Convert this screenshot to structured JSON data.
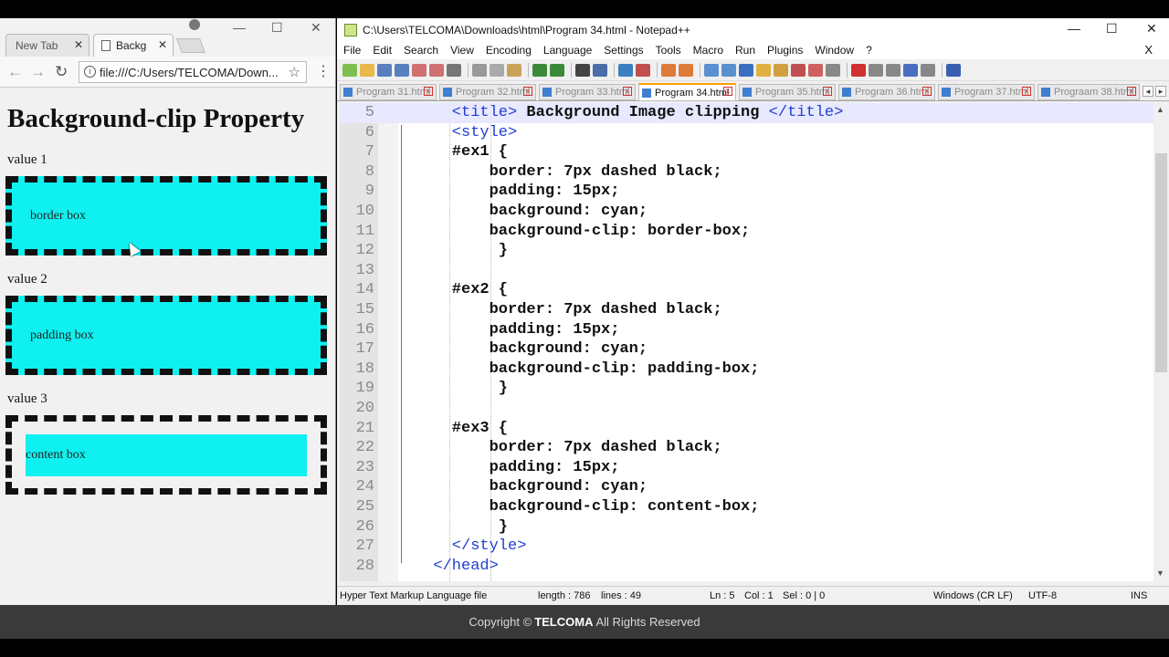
{
  "footer": {
    "prefix": "Copyright ©",
    "brand": "TELCOMA",
    "suffix": "All Rights Reserved"
  },
  "chrome": {
    "tabs": [
      {
        "label": "New Tab"
      },
      {
        "label": "Backg"
      }
    ],
    "url": "file:///C:/Users/TELCOMA/Down...",
    "page": {
      "title": "Background-clip Property",
      "sections": [
        {
          "label": "value 1",
          "box_text": "border box"
        },
        {
          "label": "value 2",
          "box_text": "padding box"
        },
        {
          "label": "value 3",
          "box_text": "content box"
        }
      ]
    }
  },
  "npp": {
    "title": "C:\\Users\\TELCOMA\\Downloads\\html\\Program 34.html - Notepad++",
    "menu": [
      "File",
      "Edit",
      "Search",
      "View",
      "Encoding",
      "Language",
      "Settings",
      "Tools",
      "Macro",
      "Run",
      "Plugins",
      "Window",
      "?"
    ],
    "menu_close": "X",
    "tabs": [
      "Program 31.html",
      "Program 32.html",
      "Program 33.html",
      "Program 34.html",
      "Program 35.html",
      "Program 36.html",
      "Program 37.html",
      "Prograam 38.html"
    ],
    "lines": [
      {
        "n": "5",
        "parts": [
          [
            "tag",
            "<title>"
          ],
          [
            "plain",
            " Background Image clipping "
          ],
          [
            "tag",
            "</title>"
          ]
        ]
      },
      {
        "n": "6",
        "parts": [
          [
            "tag",
            "<style>"
          ]
        ]
      },
      {
        "n": "7",
        "parts": [
          [
            "plain",
            "#ex1 {"
          ]
        ]
      },
      {
        "n": "8",
        "parts": [
          [
            "plain",
            "    border: 7px dashed black;"
          ]
        ]
      },
      {
        "n": "9",
        "parts": [
          [
            "plain",
            "    padding: 15px;"
          ]
        ]
      },
      {
        "n": "10",
        "parts": [
          [
            "plain",
            "    background: cyan;"
          ]
        ]
      },
      {
        "n": "11",
        "parts": [
          [
            "plain",
            "    background-clip: border-box;"
          ]
        ]
      },
      {
        "n": "12",
        "parts": [
          [
            "plain",
            "     }"
          ]
        ]
      },
      {
        "n": "13",
        "parts": []
      },
      {
        "n": "14",
        "parts": [
          [
            "plain",
            "#ex2 {"
          ]
        ]
      },
      {
        "n": "15",
        "parts": [
          [
            "plain",
            "    border: 7px dashed black;"
          ]
        ]
      },
      {
        "n": "16",
        "parts": [
          [
            "plain",
            "    padding: 15px;"
          ]
        ]
      },
      {
        "n": "17",
        "parts": [
          [
            "plain",
            "    background: cyan;"
          ]
        ]
      },
      {
        "n": "18",
        "parts": [
          [
            "plain",
            "    background-clip: padding-box;"
          ]
        ]
      },
      {
        "n": "19",
        "parts": [
          [
            "plain",
            "     }"
          ]
        ]
      },
      {
        "n": "20",
        "parts": []
      },
      {
        "n": "21",
        "parts": [
          [
            "plain",
            "#ex3 {"
          ]
        ]
      },
      {
        "n": "22",
        "parts": [
          [
            "plain",
            "    border: 7px dashed black;"
          ]
        ]
      },
      {
        "n": "23",
        "parts": [
          [
            "plain",
            "    padding: 15px;"
          ]
        ]
      },
      {
        "n": "24",
        "parts": [
          [
            "plain",
            "    background: cyan;"
          ]
        ]
      },
      {
        "n": "25",
        "parts": [
          [
            "plain",
            "    background-clip: content-box;"
          ]
        ]
      },
      {
        "n": "26",
        "parts": [
          [
            "plain",
            "     }"
          ]
        ]
      },
      {
        "n": "27",
        "parts": [
          [
            "tag",
            "</style>"
          ]
        ]
      },
      {
        "n": "28",
        "parts": [
          [
            "tag",
            "</head>"
          ]
        ]
      }
    ],
    "status": {
      "file_type": "Hyper Text Markup Language file",
      "length": "length : 786",
      "lines": "lines : 49",
      "ln": "Ln : 5",
      "col": "Col : 1",
      "sel": "Sel : 0 | 0",
      "eol": "Windows (CR LF)",
      "encoding": "UTF-8",
      "mode": "INS"
    }
  }
}
